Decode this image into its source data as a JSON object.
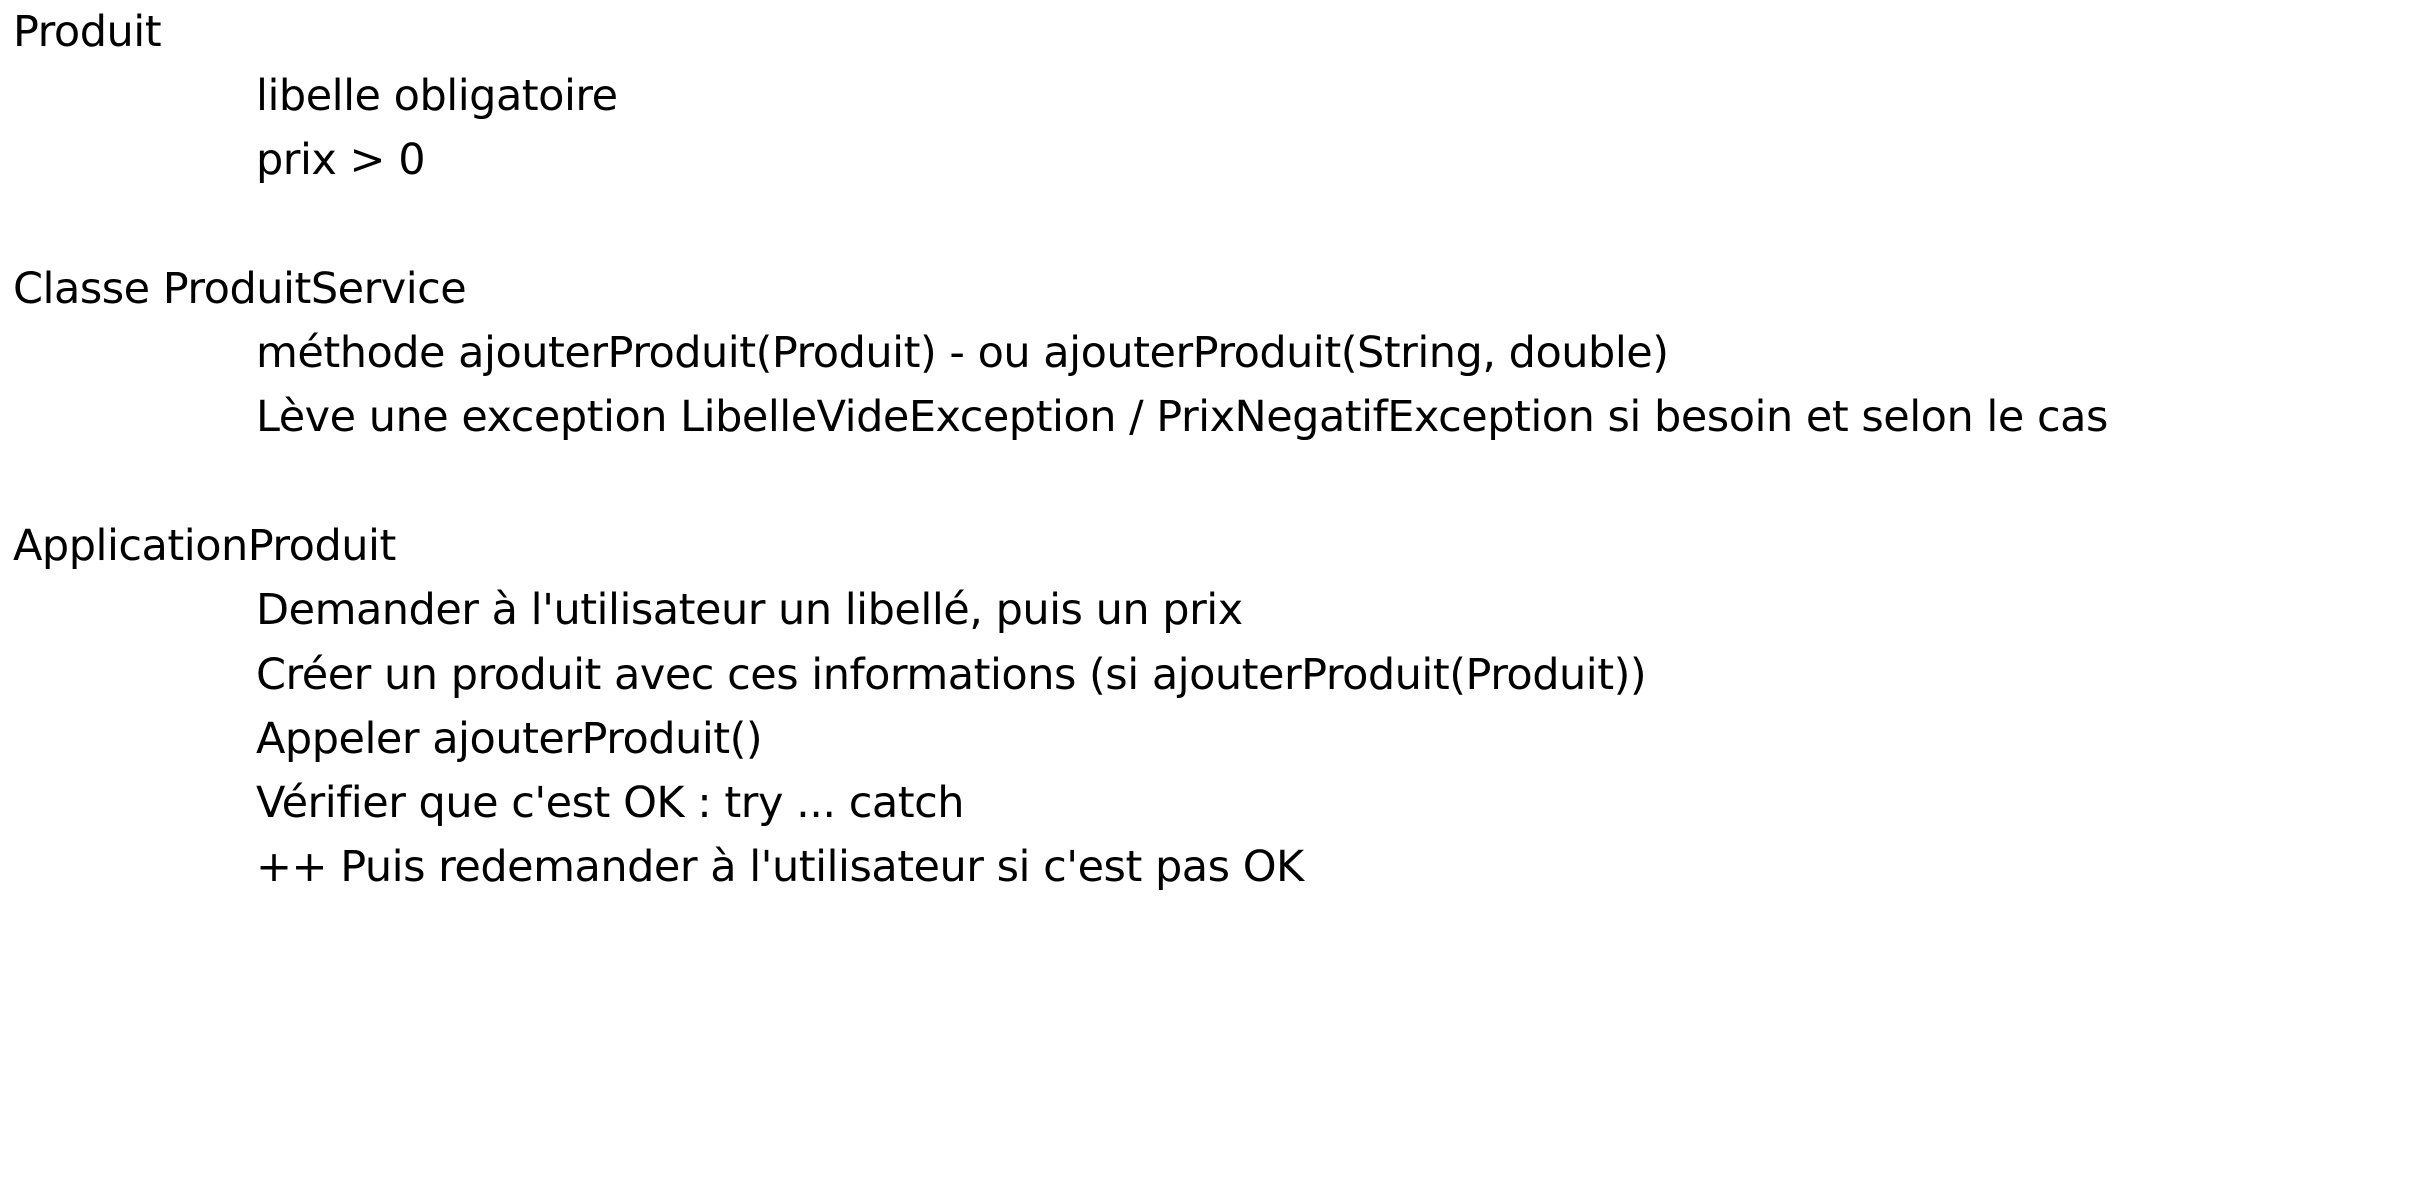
{
  "sections": [
    {
      "title": "Produit",
      "items": [
        "libelle obligatoire",
        "prix > 0"
      ]
    },
    {
      "title": "Classe ProduitService",
      "items": [
        "méthode ajouterProduit(Produit) - ou ajouterProduit(String, double)",
        "Lève une exception LibelleVideException / PrixNegatifException si besoin et selon le cas"
      ]
    },
    {
      "title": "ApplicationProduit",
      "items": [
        "Demander à l'utilisateur un libellé, puis un prix",
        "Créer un produit avec ces informations (si ajouterProduit(Produit))",
        "Appeler ajouterProduit()",
        "Vérifier que c'est OK : try ... catch",
        "++ Puis redemander à l'utilisateur si c'est pas OK"
      ]
    }
  ]
}
